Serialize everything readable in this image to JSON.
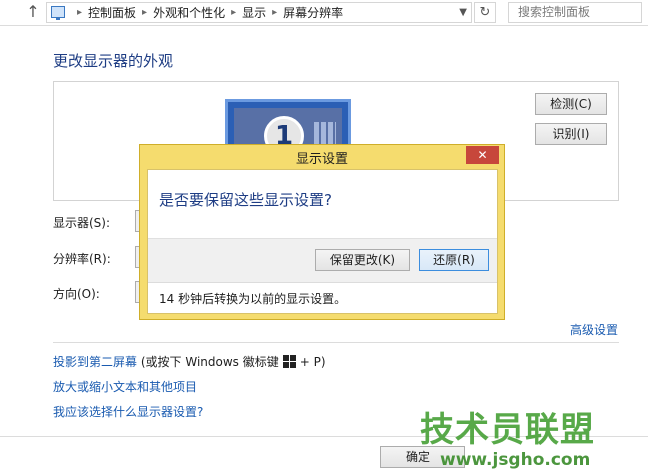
{
  "address_bar": {
    "breadcrumbs": [
      "控制面板",
      "外观和个性化",
      "显示",
      "屏幕分辨率"
    ],
    "search_placeholder": "搜索控制面板"
  },
  "page": {
    "title": "更改显示器的外观",
    "monitor_number": "1",
    "detect_label": "检测(C)",
    "identify_label": "识别(I)",
    "display_label": "显示器(S):",
    "resolution_label": "分辨率(R):",
    "orientation_label": "方向(O):",
    "advanced_link": "高级设置",
    "project_link": "投影到第二屏幕",
    "project_hint_pre": "(或按下 Windows 徽标键",
    "project_hint_post": "+ P)",
    "text_size_link": "放大或缩小文本和其他项目",
    "which_settings_link": "我应该选择什么显示器设置?",
    "ok_label": "确定"
  },
  "dialog": {
    "title": "显示设置",
    "question": "是否要保留这些显示设置?",
    "keep_label": "保留更改(K)",
    "revert_label": "还原(R)",
    "countdown_text": "14 秒钟后转换为以前的显示设置。"
  },
  "watermark": {
    "main": "技术员联盟",
    "sub": "www.jsgho.com"
  },
  "colors": {
    "link": "#1a5bb0",
    "title": "#1e3d84",
    "dialog_frame": "#f5dc6e",
    "close_button": "#c7473b",
    "watermark": "#4aa23a"
  }
}
